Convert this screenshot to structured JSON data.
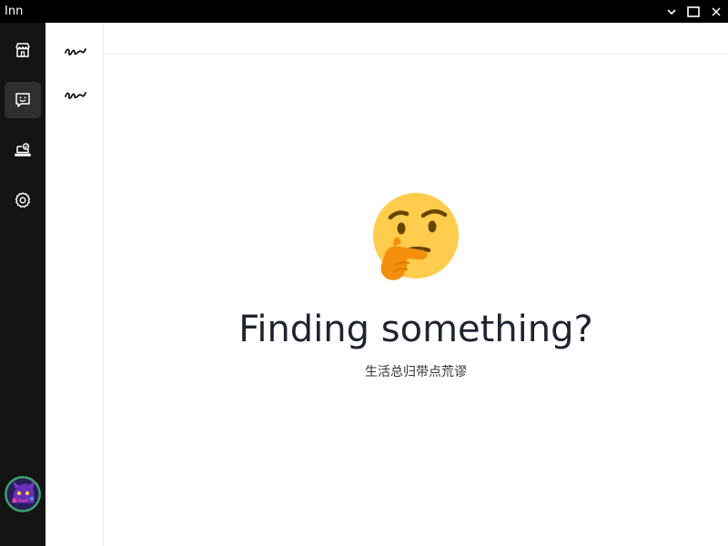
{
  "window": {
    "title": "Inn",
    "controls": [
      "chevron-down-icon",
      "maximize-icon",
      "close-icon"
    ]
  },
  "rail": {
    "items": [
      {
        "icon": "store-icon",
        "active": false
      },
      {
        "icon": "message-smile-icon",
        "active": true
      },
      {
        "icon": "laptop-badge-icon",
        "active": false
      },
      {
        "icon": "gear-icon",
        "active": false
      }
    ],
    "avatar": "user-avatar"
  },
  "list": {
    "items": [
      {
        "icon": "signature-icon"
      },
      {
        "icon": "signature-icon"
      }
    ]
  },
  "empty_state": {
    "emoji": "thinking-face-emoji",
    "title": "Finding something?",
    "subtitle": "生活总归带点荒谬"
  },
  "colors": {
    "titlebar": "#000000",
    "rail": "#141414",
    "rail_active": "#2f2f2f",
    "title_text": "#1f2430"
  }
}
